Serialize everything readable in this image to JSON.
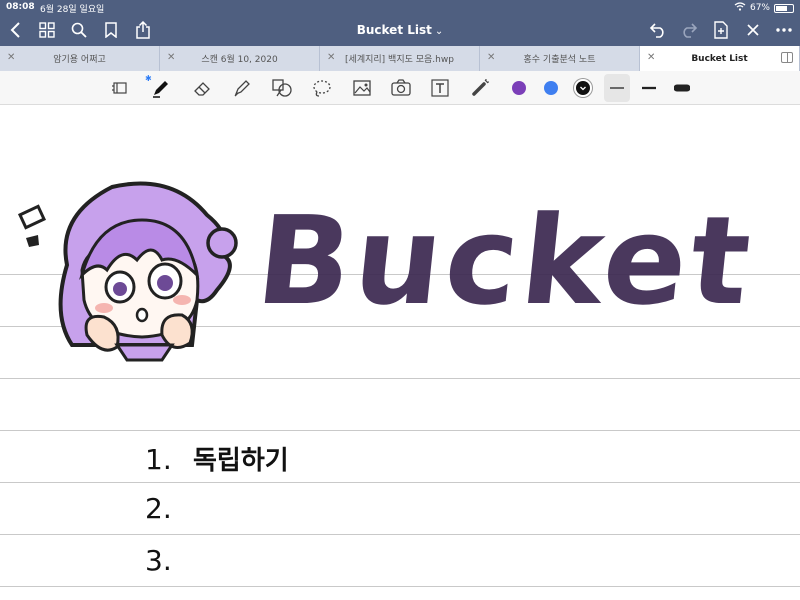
{
  "status": {
    "time": "08:08",
    "date": "6월 28일 일요일",
    "battery": "67%",
    "battery_level": 0.67
  },
  "header": {
    "title": "Bucket List"
  },
  "tabs": [
    {
      "label": "암기용 어쩌고",
      "active": false
    },
    {
      "label": "스캔 6월 10, 2020",
      "active": false
    },
    {
      "label": "[세계지리] 백지도 모음.hwp",
      "active": false
    },
    {
      "label": "홍수 기출분석 노트",
      "active": false
    },
    {
      "label": "Bucket List",
      "active": true
    }
  ],
  "toolbar": {
    "tools": [
      "lasso-icon",
      "pen-icon",
      "eraser-icon",
      "highlighter-icon",
      "shapes-icon",
      "lasso-selection-icon",
      "image-icon",
      "camera-icon",
      "text-icon",
      "laser-pointer-icon"
    ],
    "colors": [
      "#7b3fb8",
      "#3f7ff0",
      "#111111"
    ],
    "selected_color": "#111111"
  },
  "note": {
    "heading": "Bucket L",
    "items": [
      {
        "num": "1.",
        "text": "독립하기"
      },
      {
        "num": "2.",
        "text": ""
      },
      {
        "num": "3.",
        "text": ""
      }
    ]
  }
}
